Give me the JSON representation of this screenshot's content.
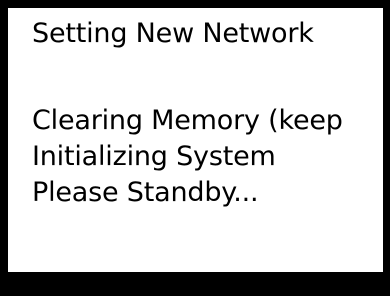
{
  "screen": {
    "title": "Setting New Network",
    "messages": [
      "Clearing Memory (keep",
      "Initializing System",
      "Please Standby..."
    ]
  },
  "colors": {
    "bezel": "#000000",
    "background": "#ffffff",
    "text": "#000000"
  }
}
